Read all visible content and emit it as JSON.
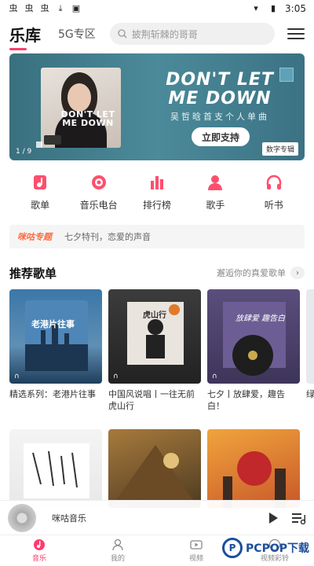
{
  "status": {
    "time": "3:05"
  },
  "header": {
    "title": "乐库",
    "tab_5g": "5G专区",
    "search_placeholder": "披荆斩棘的哥哥"
  },
  "banner": {
    "cover_text": "DON'T LET ME DOWN",
    "title": "DON'T LET ME DOWN",
    "subtitle": "吴哲晗首支个人单曲",
    "button": "立即支持",
    "tag": "数字专辑",
    "page": "1 / 9"
  },
  "categories": [
    {
      "label": "歌单",
      "icon": "playlist-icon"
    },
    {
      "label": "音乐电台",
      "icon": "radio-icon"
    },
    {
      "label": "排行榜",
      "icon": "chart-icon"
    },
    {
      "label": "歌手",
      "icon": "singer-icon"
    },
    {
      "label": "听书",
      "icon": "headphones-icon"
    }
  ],
  "notice": {
    "tag": "咪咕专题",
    "text": "七夕特刊，恋爱的声音"
  },
  "section": {
    "title": "推荐歌单",
    "more": "邂逅你的真爱歌单"
  },
  "cards": [
    {
      "caption": "精选系列：老港片往事",
      "cover_text": "老港片往事"
    },
    {
      "caption": "中国风说唱丨一往无前虎山行",
      "cover_text": "虎山行"
    },
    {
      "caption": "七夕丨放肆爱，趣告白！",
      "cover_text": "放肆爱 趣告白"
    },
    {
      "caption": "绿净",
      "cover_text": ""
    }
  ],
  "player": {
    "title": "咪咕音乐"
  },
  "tabs": [
    {
      "label": "音乐",
      "icon": "music-icon",
      "active": true
    },
    {
      "label": "我的",
      "icon": "profile-icon",
      "active": false
    },
    {
      "label": "视频",
      "icon": "video-icon",
      "active": false
    },
    {
      "label": "视频彩铃",
      "icon": "ringtone-icon",
      "active": false
    }
  ],
  "watermark": {
    "text": "PCPOP下载"
  },
  "colors": {
    "accent": "#ff3a6b",
    "banner": "#3f7e8e"
  }
}
